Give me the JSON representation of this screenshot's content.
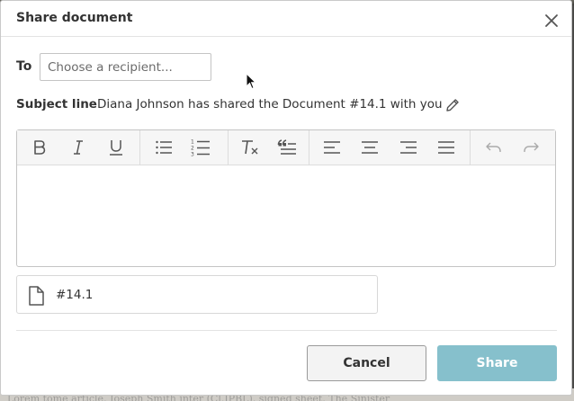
{
  "dialog": {
    "title": "Share document",
    "close_icon": "close-icon"
  },
  "recipient": {
    "label": "To",
    "placeholder": "Choose a recipient...",
    "value": ""
  },
  "subject": {
    "label": "Subject line",
    "text": "Diana Johnson has shared the Document #14.1 with you",
    "edit_icon": "pencil-icon"
  },
  "toolbar": {
    "buttons": [
      {
        "name": "bold-button",
        "icon": "bold-icon"
      },
      {
        "name": "italic-button",
        "icon": "italic-icon"
      },
      {
        "name": "underline-button",
        "icon": "underline-icon"
      },
      {
        "name": "bullet-list-button",
        "icon": "bullet-list-icon"
      },
      {
        "name": "numbered-list-button",
        "icon": "numbered-list-icon"
      },
      {
        "name": "clear-formatting-button",
        "icon": "clear-formatting-icon"
      },
      {
        "name": "blockquote-button",
        "icon": "blockquote-icon"
      },
      {
        "name": "align-left-button",
        "icon": "align-left-icon"
      },
      {
        "name": "align-center-button",
        "icon": "align-center-icon"
      },
      {
        "name": "align-right-button",
        "icon": "align-right-icon"
      },
      {
        "name": "justify-button",
        "icon": "justify-icon"
      },
      {
        "name": "undo-button",
        "icon": "undo-icon"
      },
      {
        "name": "redo-button",
        "icon": "redo-icon"
      }
    ]
  },
  "editor": {
    "content": ""
  },
  "attachment": {
    "icon": "file-icon",
    "name": "#14.1"
  },
  "actions": {
    "cancel_label": "Cancel",
    "share_label": "Share"
  },
  "colors": {
    "share_button": "#86c0cc",
    "text": "#333333",
    "border": "#c4c4c4"
  },
  "background_text": "Lorem tome article, Joseph Smith inter (Cl.IPBL), signed sheet, The Sinister"
}
